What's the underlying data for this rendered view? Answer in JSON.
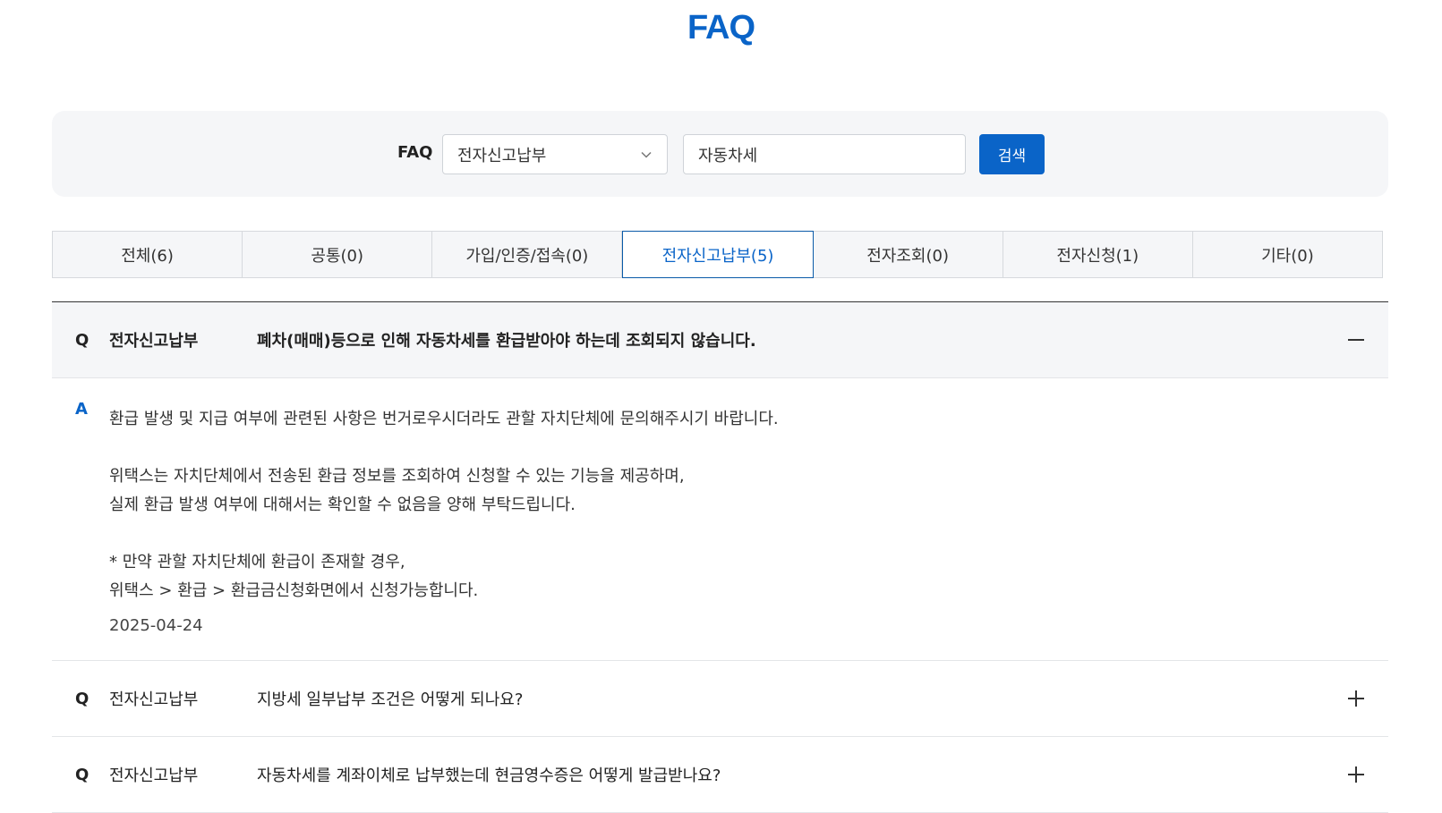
{
  "page": {
    "title": "FAQ"
  },
  "search": {
    "label": "FAQ",
    "category_selected": "전자신고납부",
    "keyword_value": "자동차세",
    "button_label": "검색"
  },
  "tabs": [
    {
      "label": "전체(6)",
      "active": false
    },
    {
      "label": "공통(0)",
      "active": false
    },
    {
      "label": "가입/인증/접속(0)",
      "active": false
    },
    {
      "label": "전자신고납부(5)",
      "active": true
    },
    {
      "label": "전자조회(0)",
      "active": false
    },
    {
      "label": "전자신청(1)",
      "active": false
    },
    {
      "label": "기타(0)",
      "active": false
    }
  ],
  "faq": {
    "q_mark": "Q",
    "a_mark": "A",
    "items": [
      {
        "category": "전자신고납부",
        "question": "폐차(매매)등으로 인해 자동차세를 환급받아야 하는데 조회되지 않습니다.",
        "expanded": true,
        "toggle_icon": "minus-icon",
        "answer": {
          "p1": "환급 발생 및 지급 여부에 관련된 사항은 번거로우시더라도 관할 자치단체에 문의해주시기 바랍니다.",
          "p2_line1": "위택스는 자치단체에서 전송된 환급 정보를 조회하여 신청할 수 있는 기능을 제공하며,",
          "p2_line2": "실제 환급 발생 여부에 대해서는 확인할 수 없음을 양해 부탁드립니다.",
          "p3_line1": "* 만약 관할 자치단체에 환급이 존재할 경우,",
          "p3_line2": "위택스 > 환급 > 환급금신청화면에서 신청가능합니다.",
          "date": "2025-04-24"
        }
      },
      {
        "category": "전자신고납부",
        "question": "지방세 일부납부 조건은 어떻게 되나요?",
        "expanded": false,
        "toggle_icon": "plus-icon"
      },
      {
        "category": "전자신고납부",
        "question": "자동차세를 계좌이체로 납부했는데 현금영수증은 어떻게 발급받나요?",
        "expanded": false,
        "toggle_icon": "plus-icon"
      }
    ]
  },
  "colors": {
    "accent": "#0a64c8",
    "panel_bg": "#f5f6f8",
    "border": "#d6d9dd"
  }
}
